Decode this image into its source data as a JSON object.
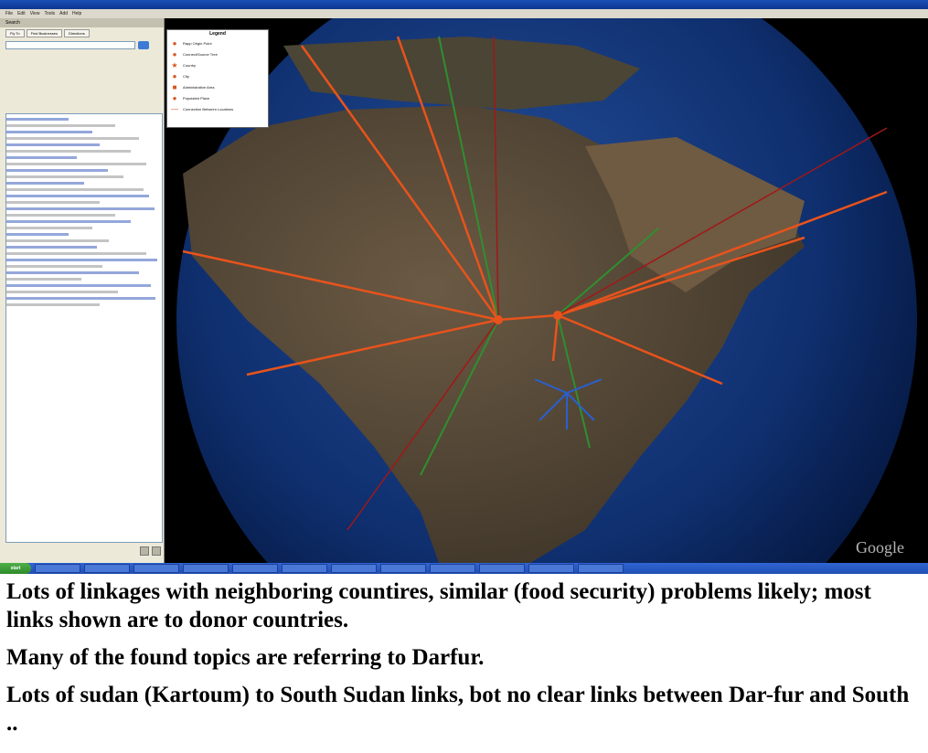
{
  "screenshot": {
    "menubar": [
      "File",
      "Edit",
      "View",
      "Tools",
      "Add",
      "Help"
    ],
    "sidebar": {
      "search_panel_title": "Search",
      "tabs": [
        "Fly To",
        "Find Businesses",
        "Directions"
      ],
      "search_value": ""
    },
    "map": {
      "legend": {
        "title": "Legend",
        "items": [
          {
            "icon": "pin-icon",
            "label": "Rapp Origin Point"
          },
          {
            "icon": "pin-icon",
            "label": "Connect/Source Tree"
          },
          {
            "icon": "star-icon",
            "label": "Country"
          },
          {
            "icon": "dot-icon",
            "label": "City"
          },
          {
            "icon": "square-icon",
            "label": "Administrative Area"
          },
          {
            "icon": "dot-icon",
            "label": "Populated Place"
          },
          {
            "icon": "line-icon",
            "label": "Connection Between Locations"
          }
        ]
      },
      "watermark": "Google",
      "colors": {
        "ocean": "#0f2f6e",
        "land": "#5a4a36",
        "desert": "#8a6a48",
        "links_orange": "#e8531c",
        "links_green": "#2f8f2f",
        "links_blue": "#2a5fd0",
        "links_red": "#a01818"
      }
    },
    "taskbar": {
      "start_label": "start"
    }
  },
  "caption": [
    "Lots of linkages with neighboring countires, similar (food security) problems likely; most links shown are to donor countries.",
    "Many of the found topics are referring to Darfur.",
    "Lots of sudan (Kartoum) to South Sudan links, bot no clear links between Dar-fur and South .."
  ]
}
